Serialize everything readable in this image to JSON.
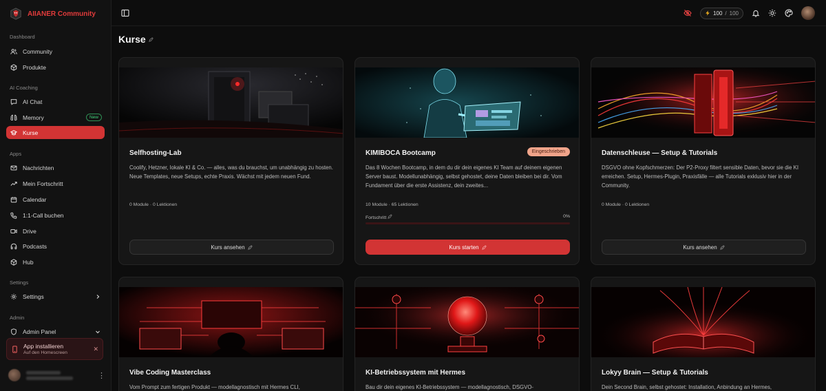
{
  "brand": {
    "name": "AIIANER Community"
  },
  "sidebar": {
    "sections": [
      {
        "label": "Dashboard",
        "items": [
          {
            "label": "Community",
            "icon": "users-icon"
          },
          {
            "label": "Produkte",
            "icon": "box-icon"
          }
        ]
      },
      {
        "label": "AI Coaching",
        "items": [
          {
            "label": "AI Chat",
            "icon": "chat-icon"
          },
          {
            "label": "Memory",
            "icon": "memory-icon",
            "badge": "New"
          },
          {
            "label": "Kurse",
            "icon": "graduation-cap-icon",
            "active": true
          }
        ]
      },
      {
        "label": "Apps",
        "items": [
          {
            "label": "Nachrichten",
            "icon": "mail-icon"
          },
          {
            "label": "Mein Fortschritt",
            "icon": "trending-up-icon"
          },
          {
            "label": "Calendar",
            "icon": "calendar-icon"
          },
          {
            "label": "1:1-Call buchen",
            "icon": "phone-icon"
          },
          {
            "label": "Drive",
            "icon": "video-icon"
          },
          {
            "label": "Podcasts",
            "icon": "headphones-icon"
          },
          {
            "label": "Hub",
            "icon": "cube-icon"
          }
        ]
      },
      {
        "label": "Settings",
        "items": [
          {
            "label": "Settings",
            "icon": "gear-icon",
            "chevron": "right"
          }
        ]
      },
      {
        "label": "Admin",
        "items": [
          {
            "label": "Admin Panel",
            "icon": "shield-icon",
            "chevron": "down"
          }
        ]
      }
    ],
    "install": {
      "title": "App installieren",
      "subtitle": "Auf den Homescreen"
    }
  },
  "topbar": {
    "credits_used": "100",
    "credits_separator": "/",
    "credits_total": "100"
  },
  "page": {
    "title": "Kurse"
  },
  "courses": [
    {
      "title": "Selfhosting-Lab",
      "description": "Coolify, Hetzner, lokale KI & Co. — alles, was du brauchst, um unabhängig zu hosten. Neue Templates, neue Setups, echte Praxis. Wächst mit jedem neuen Fund.",
      "meta": "0 Module · 0 Lektionen",
      "button": "Kurs ansehen"
    },
    {
      "title": "KIMIBOCA Bootcamp",
      "badge": "Eingeschrieben",
      "description": "Das 8 Wochen Bootcamp, in dem du dir dein eigenes KI Team auf deinem eigenen Server baust. Modellunabhängig, selbst gehostet, deine Daten bleiben bei dir. Vom Fundament über die erste Assistenz, dein zweites...",
      "meta": "10 Module · 65 Lektionen",
      "progress_label": "Fortschritt",
      "progress_value": 0,
      "progress_text": "0%",
      "button": "Kurs starten"
    },
    {
      "title": "Datenschleuse — Setup & Tutorials",
      "description": "DSGVO ohne Kopfschmerzen: Der P2-Proxy filtert sensible Daten, bevor sie die KI erreichen. Setup, Hermes-Plugin, Praxisfälle — alle Tutorials exklusiv hier in der Community.",
      "meta": "0 Module · 0 Lektionen",
      "button": "Kurs ansehen"
    },
    {
      "title": "Vibe Coding Masterclass",
      "description": "Vom Prompt zum fertigen Produkt — modellagnostisch mit Hermes CLI,"
    },
    {
      "title": "KI-Betriebssystem mit Hermes",
      "description": "Bau dir dein eigenes KI-Betriebssystem — modellagnostisch, DSGVO-"
    },
    {
      "title": "Lokyy Brain — Setup & Tutorials",
      "description": "Dein Second Brain, selbst gehostet: Installation, Anbindung an Hermes,"
    }
  ]
}
